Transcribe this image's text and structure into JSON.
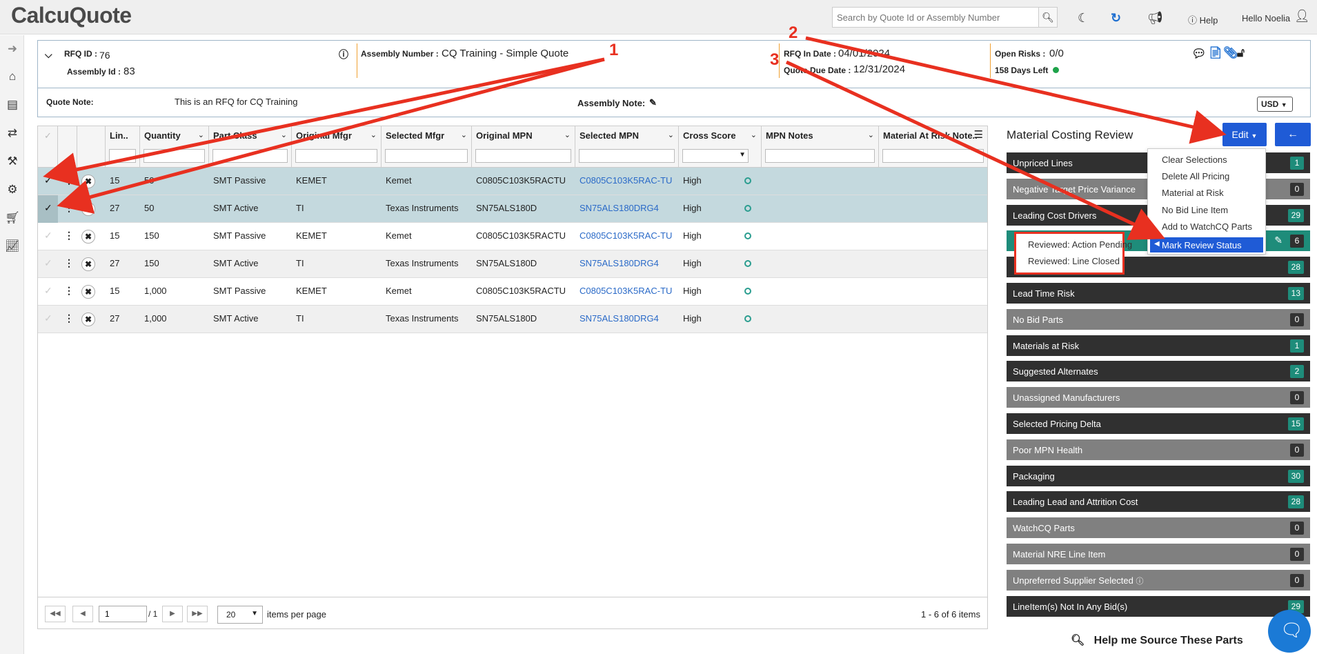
{
  "app": {
    "logo": "CalcuQuote",
    "search_placeholder": "Search by Quote Id or Assembly Number",
    "help": "Help",
    "greeting": "Hello Noelia"
  },
  "header": {
    "rfq_label": "RFQ ID :",
    "rfq_id": "76",
    "assembly_id_label": "Assembly Id :",
    "assembly_id": "83",
    "assembly_number_label": "Assembly Number :",
    "assembly_number": "CQ Training - Simple Quote",
    "rfq_in_date_label": "RFQ In Date :",
    "rfq_in_date": "04/01/2024",
    "due_date_label": "Quote Due Date :",
    "due_date": "12/31/2024",
    "open_risks_label": "Open Risks :",
    "open_risks": "0/0",
    "days_left": "158 Days Left",
    "quote_note_label": "Quote Note:",
    "quote_note": "This is an RFQ for CQ Training",
    "assembly_note_label": "Assembly Note:",
    "currency": "USD"
  },
  "grid": {
    "columns": [
      "Lin..",
      "Quantity",
      "Part Class",
      "Original Mfgr",
      "Selected Mfgr",
      "Original MPN",
      "Selected MPN",
      "Cross Score",
      "MPN Notes",
      "Material At Risk Note.."
    ],
    "rows": [
      {
        "line": "15",
        "qty": "50",
        "cls": "SMT Passive",
        "omfgr": "KEMET",
        "smfgr": "Kemet",
        "ompn": "C0805C103K5RACTU",
        "smpn": "C0805C103K5RAC-TU",
        "score": "High"
      },
      {
        "line": "27",
        "qty": "50",
        "cls": "SMT Active",
        "omfgr": "TI",
        "smfgr": "Texas Instruments",
        "ompn": "SN75ALS180D",
        "smpn": "SN75ALS180DRG4",
        "score": "High"
      },
      {
        "line": "15",
        "qty": "150",
        "cls": "SMT Passive",
        "omfgr": "KEMET",
        "smfgr": "Kemet",
        "ompn": "C0805C103K5RACTU",
        "smpn": "C0805C103K5RAC-TU",
        "score": "High"
      },
      {
        "line": "27",
        "qty": "150",
        "cls": "SMT Active",
        "omfgr": "TI",
        "smfgr": "Texas Instruments",
        "ompn": "SN75ALS180D",
        "smpn": "SN75ALS180DRG4",
        "score": "High"
      },
      {
        "line": "15",
        "qty": "1,000",
        "cls": "SMT Passive",
        "omfgr": "KEMET",
        "smfgr": "Kemet",
        "ompn": "C0805C103K5RACTU",
        "smpn": "C0805C103K5RAC-TU",
        "score": "High"
      },
      {
        "line": "27",
        "qty": "1,000",
        "cls": "SMT Active",
        "omfgr": "TI",
        "smfgr": "Texas Instruments",
        "ompn": "SN75ALS180D",
        "smpn": "SN75ALS180DRG4",
        "score": "High"
      }
    ],
    "page": "1",
    "page_of": "/ 1",
    "page_size": "20",
    "items_per_page": "items per page",
    "summary": "1 - 6 of 6 items"
  },
  "review": {
    "title": "Material Costing Review",
    "edit": "Edit",
    "bars": [
      {
        "label": "Unpriced Lines",
        "count": "1"
      },
      {
        "label": "Negative Target Price Variance",
        "count": "0"
      },
      {
        "label": "Leading Cost Drivers",
        "count": "29"
      },
      {
        "label": "",
        "count": "6"
      },
      {
        "label": "",
        "count": "28"
      },
      {
        "label": "Lead Time Risk",
        "count": "13"
      },
      {
        "label": "No Bid Parts",
        "count": "0"
      },
      {
        "label": "Materials at Risk",
        "count": "1"
      },
      {
        "label": "Suggested Alternates",
        "count": "2"
      },
      {
        "label": "Unassigned Manufacturers",
        "count": "0"
      },
      {
        "label": "Selected Pricing Delta",
        "count": "15"
      },
      {
        "label": "Poor MPN Health",
        "count": "0"
      },
      {
        "label": "Packaging",
        "count": "30"
      },
      {
        "label": "Leading Lead and Attrition Cost",
        "count": "28"
      },
      {
        "label": "WatchCQ Parts",
        "count": "0"
      },
      {
        "label": "Material NRE Line Item",
        "count": "0"
      },
      {
        "label": "Unpreferred Supplier Selected",
        "count": "0"
      },
      {
        "label": "LineItem(s) Not In Any Bid(s)",
        "count": "29"
      }
    ],
    "menu": [
      "Clear Selections",
      "Delete All Pricing",
      "Material at Risk",
      "No Bid Line Item",
      "Add to WatchCQ Parts",
      "Mark Review Status"
    ],
    "submenu": [
      "Reviewed: Action Pending",
      "Reviewed: Line Closed"
    ]
  },
  "annotations": [
    "1",
    "2",
    "3"
  ],
  "help_source": "Help me Source These Parts"
}
